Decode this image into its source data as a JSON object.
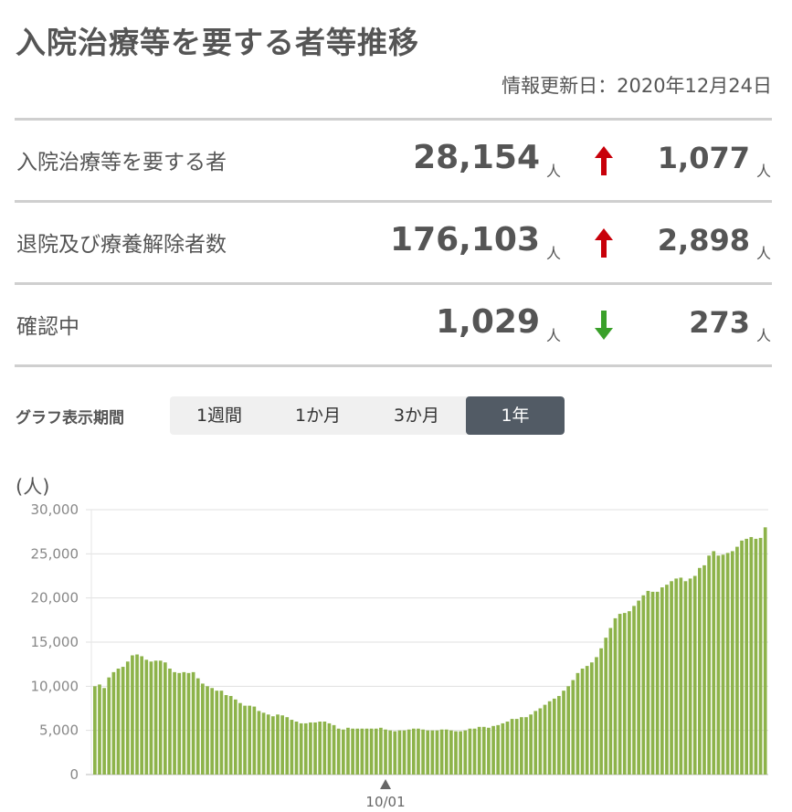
{
  "header": {
    "title": "入院治療等を要する者等推移",
    "updated": "情報更新日：2020年12月24日"
  },
  "stats": [
    {
      "label": "入院治療等を要する者",
      "value": "28,154",
      "unit": "人",
      "direction": "up",
      "delta": "1,077",
      "delta_unit": "人"
    },
    {
      "label": "退院及び療養解除者数",
      "value": "176,103",
      "unit": "人",
      "direction": "up",
      "delta": "2,898",
      "delta_unit": "人"
    },
    {
      "label": "確認中",
      "value": "1,029",
      "unit": "人",
      "direction": "down",
      "delta": "273",
      "delta_unit": "人"
    }
  ],
  "colors": {
    "up": "#c8000a",
    "down": "#3aa02a",
    "bar": "#8db34a",
    "grid": "#e0e0e0"
  },
  "period": {
    "label": "グラフ表示期間",
    "options": [
      "1週間",
      "1か月",
      "3か月",
      "1年"
    ],
    "selected": "1年"
  },
  "chart_data": {
    "type": "bar",
    "unit_label": "(人)",
    "ylim": [
      0,
      30000
    ],
    "yticks": [
      "0",
      "5,000",
      "10,000",
      "15,000",
      "20,000",
      "25,000",
      "30,000"
    ],
    "marker_label": "10/01",
    "marker_index": 62,
    "grid": true,
    "values": [
      10000,
      10200,
      9800,
      11000,
      11600,
      12000,
      12200,
      12800,
      13500,
      13600,
      13400,
      13000,
      12800,
      12900,
      12900,
      12700,
      12000,
      11600,
      11500,
      11600,
      11500,
      11600,
      10900,
      10300,
      10000,
      9800,
      9500,
      9500,
      9000,
      8900,
      8500,
      8100,
      7800,
      7800,
      7700,
      7200,
      7000,
      6800,
      6600,
      6800,
      6700,
      6500,
      6200,
      6000,
      5800,
      5800,
      5900,
      5900,
      6000,
      6000,
      5800,
      5600,
      5200,
      5100,
      5300,
      5200,
      5200,
      5200,
      5200,
      5200,
      5200,
      5300,
      5100,
      5000,
      4900,
      5000,
      5000,
      5100,
      5200,
      5200,
      5100,
      5000,
      5000,
      5000,
      5100,
      5100,
      5000,
      4900,
      4900,
      5000,
      5200,
      5200,
      5400,
      5400,
      5300,
      5500,
      5600,
      5800,
      6000,
      6300,
      6300,
      6500,
      6500,
      6800,
      7200,
      7500,
      7900,
      8300,
      8600,
      8900,
      9500,
      10000,
      10700,
      11500,
      12000,
      12300,
      12700,
      13300,
      14300,
      15500,
      16600,
      17700,
      18200,
      18300,
      18500,
      19100,
      19700,
      20300,
      20800,
      20700,
      20700,
      21200,
      21500,
      21900,
      22200,
      22300,
      21900,
      22200,
      22500,
      23400,
      23700,
      24800,
      25300,
      24800,
      24900,
      25100,
      25300,
      25800,
      26500,
      26700,
      26900,
      26700,
      26800,
      28000
    ]
  }
}
